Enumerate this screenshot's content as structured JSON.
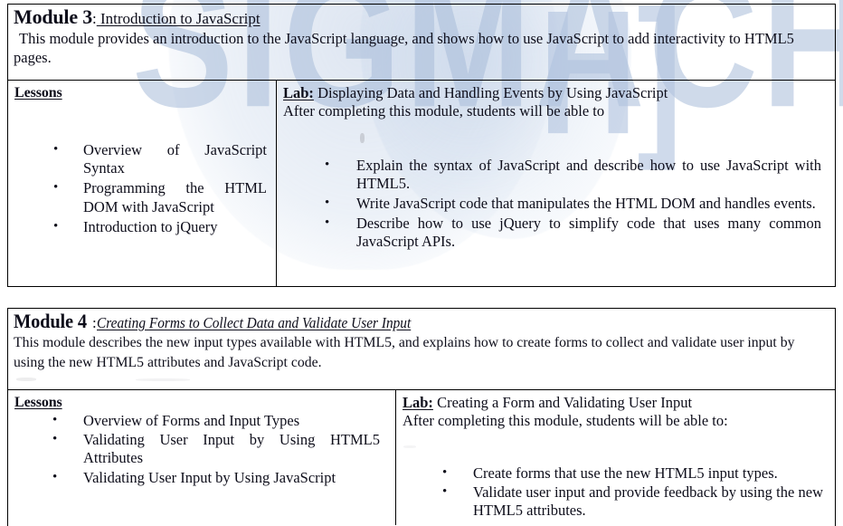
{
  "document": {
    "watermark": {
      "word": "SIGMACH",
      "mark": "H]",
      "color": "#a8bcd9"
    },
    "background_color": "#ffffff",
    "text_color": "#0d0d1a",
    "border_color": "#000000"
  },
  "modules": [
    {
      "label": "Module 3",
      "colon": ":",
      "subtitle": " Introduction to JavaScript",
      "description": "This module provides an introduction to the JavaScript language, and shows how to use JavaScript to add interactivity to HTML5 pages.",
      "lessons": {
        "heading": "Lessons",
        "items": [
          "Overview of JavaScript Syntax",
          "Programming the HTML DOM with JavaScript",
          "Introduction to jQuery"
        ]
      },
      "lab": {
        "key": "Lab:",
        "title": " Displaying Data and Handling Events by Using JavaScript",
        "after_text": "After completing this module, students will be able to",
        "objectives": [
          "Explain the syntax of JavaScript and describe how to use JavaScript with HTML5.",
          "Write JavaScript code that manipulates the HTML DOM and handles events.",
          "Describe how to use jQuery to simplify code that uses many common JavaScript APIs."
        ]
      }
    },
    {
      "label": "Module 4",
      "colon": ":",
      "subtitle": " Creating Forms to Collect Data and Validate User Input",
      "description": "This module describes the new input types available with HTML5, and explains how to create forms to collect and validate user input by using the new HTML5 attributes and JavaScript code.",
      "lessons": {
        "heading": "Lessons",
        "items": [
          "Overview of Forms and Input Types",
          "Validating User Input by Using HTML5 Attributes",
          "Validating User Input by Using JavaScript"
        ]
      },
      "lab": {
        "key": "Lab:",
        "title": " Creating a Form and Validating User Input",
        "after_text": "After completing this module, students will be able to:",
        "objectives": [
          "Create forms that use the new HTML5 input types.",
          "Validate user input and provide feedback by using the new HTML5 attributes."
        ]
      }
    }
  ]
}
